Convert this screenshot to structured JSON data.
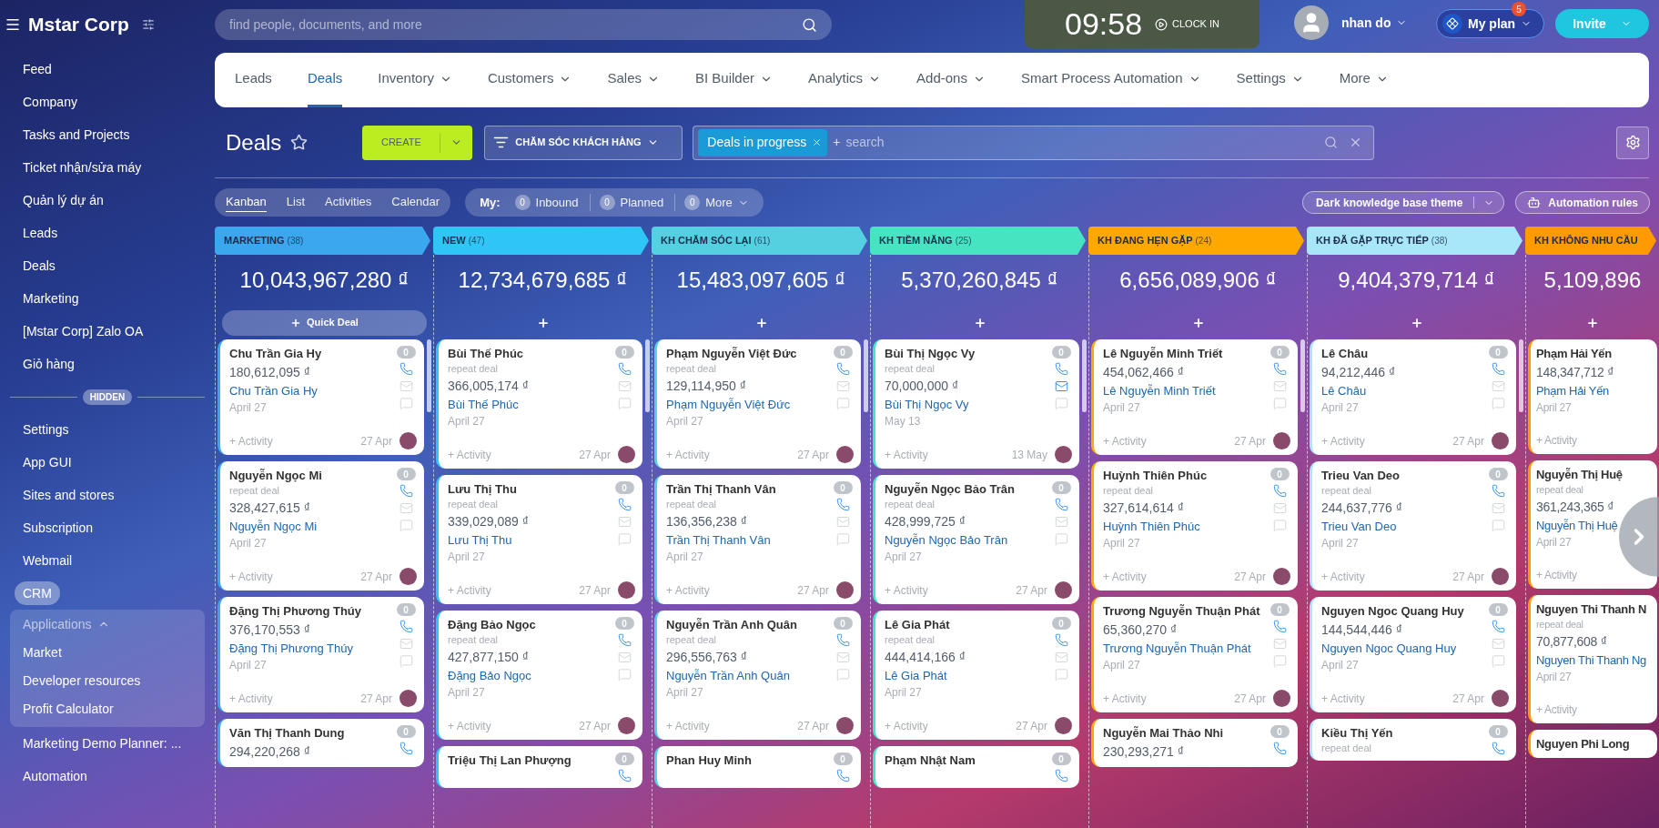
{
  "sidebar": {
    "company": "Mstar Corp",
    "items": [
      {
        "kind": "item",
        "label": "Feed",
        "selected": false
      },
      {
        "kind": "item",
        "label": "Company",
        "selected": false
      },
      {
        "kind": "item",
        "label": "Tasks and Projects",
        "selected": false
      },
      {
        "kind": "item",
        "label": "Ticket nhận/sửa máy",
        "selected": false
      },
      {
        "kind": "item",
        "label": "Quản lý dự án",
        "selected": false
      },
      {
        "kind": "item",
        "label": "Leads",
        "selected": false
      },
      {
        "kind": "item",
        "label": "Deals",
        "selected": false
      },
      {
        "kind": "item",
        "label": "Marketing",
        "selected": false
      },
      {
        "kind": "item",
        "label": "[Mstar Corp] Zalo OA",
        "selected": false
      },
      {
        "kind": "item",
        "label": "Giỏ hàng",
        "selected": false
      },
      {
        "kind": "divider",
        "label": "HIDDEN"
      },
      {
        "kind": "item",
        "label": "Settings",
        "selected": false
      },
      {
        "kind": "item",
        "label": "App GUI",
        "selected": false
      },
      {
        "kind": "item",
        "label": "Sites and stores",
        "selected": false
      },
      {
        "kind": "item",
        "label": "Subscription",
        "selected": false
      },
      {
        "kind": "item",
        "label": "Webmail",
        "selected": false
      },
      {
        "kind": "item",
        "label": "CRM",
        "selected": true
      },
      {
        "kind": "group",
        "label": "Applications",
        "expanded": true,
        "children": [
          {
            "label": "Market",
            "selected": false
          },
          {
            "label": "Developer resources",
            "selected": false
          },
          {
            "label": "Profit Calculator",
            "selected": false
          }
        ]
      },
      {
        "kind": "item",
        "label": "Marketing Demo Planner: ...",
        "selected": false
      },
      {
        "kind": "item",
        "label": "Automation",
        "selected": false
      }
    ]
  },
  "header": {
    "search_placeholder": "find people, documents, and more",
    "clock": "09:58",
    "clock_in": "CLOCK IN",
    "user": "nhan do",
    "plan": "My plan",
    "plan_badge": "5",
    "invite": "Invite"
  },
  "nav": {
    "tabs": [
      {
        "label": "Leads",
        "selected": false,
        "dropdown": false
      },
      {
        "label": "Deals",
        "selected": true,
        "dropdown": false
      },
      {
        "label": "Inventory",
        "selected": false,
        "dropdown": true
      },
      {
        "label": "Customers",
        "selected": false,
        "dropdown": true
      },
      {
        "label": "Sales",
        "selected": false,
        "dropdown": true
      },
      {
        "label": "BI Builder",
        "selected": false,
        "dropdown": true
      },
      {
        "label": "Analytics",
        "selected": false,
        "dropdown": true
      },
      {
        "label": "Add-ons",
        "selected": false,
        "dropdown": true
      },
      {
        "label": "Smart Process Automation",
        "selected": false,
        "dropdown": true
      },
      {
        "label": "Settings",
        "selected": false,
        "dropdown": true
      },
      {
        "label": "More",
        "selected": false,
        "dropdown": true
      }
    ]
  },
  "toolbar": {
    "title": "Deals",
    "create": "CREATE",
    "category": "CHĂM SÓC KHÁCH HÀNG",
    "filter_chip": "Deals in progress",
    "search_prefix": "+",
    "search_placeholder": "search"
  },
  "views": {
    "tabs": [
      {
        "label": "Kanban",
        "selected": true
      },
      {
        "label": "List",
        "selected": false
      },
      {
        "label": "Activities",
        "selected": false
      },
      {
        "label": "Calendar",
        "selected": false
      }
    ],
    "counters_label": "My:",
    "counters": [
      {
        "count": "0",
        "label": "Inbound"
      },
      {
        "count": "0",
        "label": "Planned"
      },
      {
        "count": "0",
        "label": "More"
      }
    ],
    "theme": "Dark knowledge base theme",
    "automation": "Automation rules"
  },
  "columns": [
    {
      "title": "MARKETING",
      "count": "(38)",
      "color": "#3aa7ee",
      "sum": "10,043,967,280 ₫",
      "quick_deal": "Quick Deal",
      "cards": [
        {
          "name": "Chu Trần Gia Hy",
          "amount": "180,612,095 ₫",
          "contact": "Chu Trần Gia Hy",
          "date": "April 27",
          "count": "0",
          "mail_active": false,
          "activity": "+ Activity",
          "footer_date": "27 Apr"
        },
        {
          "name": "Nguyễn Ngọc Mi",
          "tag": "repeat deal",
          "amount": "328,427,615 ₫",
          "contact": "Nguyễn Ngọc Mi",
          "date": "April 27",
          "count": "0",
          "mail_active": false,
          "activity": "+ Activity",
          "footer_date": "27 Apr"
        },
        {
          "name": "Đặng Thị Phương Thúy",
          "amount": "376,170,553 ₫",
          "contact": "Đặng Thị Phương Thúy",
          "date": "April 27",
          "count": "0",
          "mail_active": false,
          "activity": "+ Activity",
          "footer_date": "27 Apr"
        },
        {
          "name": "Văn Thị Thanh Dung",
          "amount": "294,220,268 ₫",
          "count": "0"
        }
      ]
    },
    {
      "title": "NEW",
      "count": "(47)",
      "color": "#2fc6f6",
      "sum": "12,734,679,685 ₫",
      "cards": [
        {
          "name": "Bùi Thế Phúc",
          "tag": "repeat deal",
          "amount": "366,005,174 ₫",
          "contact": "Bùi Thế Phúc",
          "date": "April 27",
          "count": "0",
          "mail_active": false,
          "activity": "+ Activity",
          "footer_date": "27 Apr"
        },
        {
          "name": "Lưu Thị Thu",
          "tag": "repeat deal",
          "amount": "339,029,089 ₫",
          "contact": "Lưu Thị Thu",
          "date": "April 27",
          "count": "0",
          "mail_active": false,
          "activity": "+ Activity",
          "footer_date": "27 Apr"
        },
        {
          "name": "Đặng Bảo Ngọc",
          "tag": "repeat deal",
          "amount": "427,877,150 ₫",
          "contact": "Đặng Bảo Ngọc",
          "date": "April 27",
          "count": "0",
          "mail_active": false,
          "activity": "+ Activity",
          "footer_date": "27 Apr"
        },
        {
          "name": "Triệu Thị Lan Phượng",
          "count": "0"
        }
      ]
    },
    {
      "title": "KH CHĂM SÓC LẠI",
      "count": "(61)",
      "color": "#55d0e0",
      "sum": "15,483,097,605 ₫",
      "cards": [
        {
          "name": "Phạm Nguyễn Việt Đức",
          "tag": "repeat deal",
          "amount": "129,114,950 ₫",
          "contact": "Phạm Nguyễn Việt Đức",
          "date": "April 27",
          "count": "0",
          "mail_active": false,
          "activity": "+ Activity",
          "footer_date": "27 Apr"
        },
        {
          "name": "Trần Thị Thanh Vân",
          "tag": "repeat deal",
          "amount": "136,356,238 ₫",
          "contact": "Trần Thị Thanh Vân",
          "date": "April 27",
          "count": "0",
          "mail_active": false,
          "activity": "+ Activity",
          "footer_date": "27 Apr"
        },
        {
          "name": "Nguyễn Trần Anh Quân",
          "tag": "repeat deal",
          "amount": "296,556,763 ₫",
          "contact": "Nguyễn Trần Anh Quân",
          "date": "April 27",
          "count": "0",
          "mail_active": false,
          "activity": "+ Activity",
          "footer_date": "27 Apr"
        },
        {
          "name": "Phan Huy Minh",
          "count": "0"
        }
      ]
    },
    {
      "title": "KH TIỀM NĂNG",
      "count": "(25)",
      "color": "#47e4c2",
      "sum": "5,370,260,845 ₫",
      "cards": [
        {
          "name": "Bùi Thị Ngọc Vy",
          "tag": "repeat deal",
          "amount": "70,000,000 ₫",
          "contact": "Bùi Thị Ngọc Vy",
          "date": "May 13",
          "count": "0",
          "mail_active": true,
          "activity": "+ Activity",
          "footer_date": "13 May"
        },
        {
          "name": "Nguyễn Ngọc Bảo Trân",
          "tag": "repeat deal",
          "amount": "428,999,725 ₫",
          "contact": "Nguyễn Ngọc Bảo Trân",
          "date": "April 27",
          "count": "0",
          "mail_active": false,
          "activity": "+ Activity",
          "footer_date": "27 Apr"
        },
        {
          "name": "Lê Gia Phát",
          "tag": "repeat deal",
          "amount": "444,414,166 ₫",
          "contact": "Lê Gia Phát",
          "date": "April 27",
          "count": "0",
          "mail_active": false,
          "activity": "+ Activity",
          "footer_date": "27 Apr"
        },
        {
          "name": "Phạm Nhật Nam",
          "count": "0"
        }
      ]
    },
    {
      "title": "KH ĐANG HẸN GẶP",
      "count": "(24)",
      "color": "#ffa900",
      "sum": "6,656,089,906 ₫",
      "cards": [
        {
          "name": "Lê Nguyễn Minh Triết",
          "amount": "454,062,466 ₫",
          "contact": "Lê Nguyễn Minh Triết",
          "date": "April 27",
          "count": "0",
          "mail_active": false,
          "activity": "+ Activity",
          "footer_date": "27 Apr"
        },
        {
          "name": "Huỳnh Thiên Phúc",
          "tag": "repeat deal",
          "amount": "327,614,614 ₫",
          "contact": "Huỳnh Thiên Phúc",
          "date": "April 27",
          "count": "0",
          "mail_active": false,
          "activity": "+ Activity",
          "footer_date": "27 Apr"
        },
        {
          "name": "Trương Nguyễn Thuận Phát",
          "amount": "65,360,270 ₫",
          "contact": "Trương Nguyễn Thuận Phát",
          "date": "April 27",
          "count": "0",
          "mail_active": false,
          "activity": "+ Activity",
          "footer_date": "27 Apr"
        },
        {
          "name": "Nguyễn Mai Thảo Nhi",
          "amount": "230,293,271 ₫",
          "count": "0"
        }
      ]
    },
    {
      "title": "KH ĐÃ GẶP TRỰC TIẾP",
      "count": "(38)",
      "color": "#a8e6fa",
      "sum": "9,404,379,714 ₫",
      "cards": [
        {
          "name": "Lê Châu",
          "amount": "94,212,446 ₫",
          "contact": "Lê Châu",
          "date": "April 27",
          "count": "0",
          "mail_active": false,
          "activity": "+ Activity",
          "footer_date": "27 Apr"
        },
        {
          "name": "Trieu Van Deo",
          "tag": "repeat deal",
          "amount": "244,637,776 ₫",
          "contact": "Trieu Van Deo",
          "date": "April 27",
          "count": "0",
          "mail_active": false,
          "activity": "+ Activity",
          "footer_date": "27 Apr"
        },
        {
          "name": "Nguyen Ngoc Quang Huy",
          "amount": "144,544,446 ₫",
          "contact": "Nguyen Ngoc Quang Huy",
          "date": "April 27",
          "count": "0",
          "mail_active": false,
          "activity": "+ Activity",
          "footer_date": "27 Apr"
        },
        {
          "name": "Kiều Thị Yến",
          "tag": "repeat deal",
          "count": "0"
        }
      ]
    },
    {
      "title": "KH KHÔNG NHU CẦU",
      "color": "#ff9a00",
      "sum": "5,109,896",
      "cards": [
        {
          "name": "Phạm Hải Yến",
          "amount": "148,347,712 ₫",
          "contact": "Phạm Hải Yến",
          "date": "April 27",
          "activity": "+ Activity"
        },
        {
          "name": "Nguyễn Thị Huệ",
          "tag": "repeat deal",
          "amount": "361,243,365 ₫",
          "contact": "Nguyễn Thị Huệ",
          "date": "April 27",
          "activity": "+ Activity"
        },
        {
          "name": "Nguyen Thi Thanh N",
          "tag": "repeat deal",
          "amount": "70,877,608 ₫",
          "contact": "Nguyen Thi Thanh Ng",
          "date": "April 27",
          "activity": "+ Activity"
        },
        {
          "name": "Nguyen Phi Long"
        }
      ]
    }
  ]
}
